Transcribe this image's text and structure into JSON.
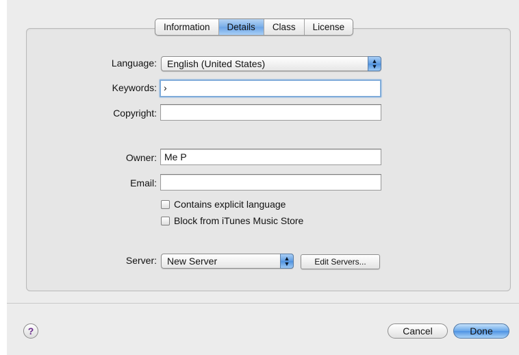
{
  "tabs": [
    {
      "label": "Information",
      "active": false
    },
    {
      "label": "Details",
      "active": true
    },
    {
      "label": "Class",
      "active": false
    },
    {
      "label": "License",
      "active": false
    }
  ],
  "form": {
    "language": {
      "label": "Language:",
      "value": "English (United States)"
    },
    "keywords": {
      "label": "Keywords:",
      "value": "›"
    },
    "copyright": {
      "label": "Copyright:",
      "value": ""
    },
    "owner": {
      "label": "Owner:",
      "value": "Me P"
    },
    "email": {
      "label": "Email:",
      "value": ""
    },
    "explicit": {
      "label": "Contains explicit language",
      "checked": false
    },
    "block_store": {
      "label": "Block from iTunes Music Store",
      "checked": false
    },
    "server": {
      "label": "Server:",
      "value": "New Server"
    },
    "edit_servers_label": "Edit Servers..."
  },
  "footer": {
    "help_label": "?",
    "cancel_label": "Cancel",
    "done_label": "Done"
  },
  "icons": {
    "popup_arrows": "up-down-arrows-icon"
  },
  "colors": {
    "accent_blue": "#6ba4e6",
    "window_bg": "#ececec",
    "help_icon": "#6a2b8c"
  }
}
